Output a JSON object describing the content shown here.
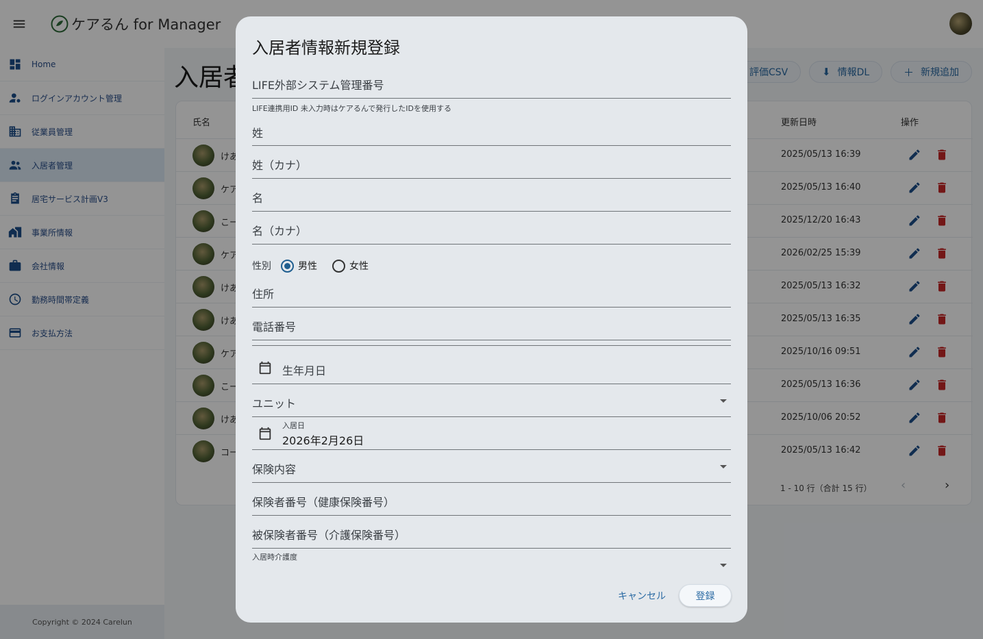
{
  "app": {
    "title": "ケアるん for Manager",
    "copyright": "Copyright © 2024 Carelun"
  },
  "sidebar": {
    "items": [
      {
        "label": "Home",
        "icon": "dashboard-icon"
      },
      {
        "label": "ログインアカウント管理",
        "icon": "manage-accounts-icon"
      },
      {
        "label": "従業員管理",
        "icon": "business-icon"
      },
      {
        "label": "入居者管理",
        "icon": "people-icon",
        "active": true
      },
      {
        "label": "居宅サービス計画V3",
        "icon": "assignment-icon"
      },
      {
        "label": "事業所情報",
        "icon": "home-work-icon"
      },
      {
        "label": "会社情報",
        "icon": "work-icon"
      },
      {
        "label": "勤務時間帯定義",
        "icon": "clock-icon"
      },
      {
        "label": "お支払方法",
        "icon": "credit-card-icon"
      }
    ]
  },
  "main": {
    "title": "入居者",
    "buttons": {
      "csv": "評価CSV",
      "download": "情報DL",
      "add": "新規追加"
    },
    "table": {
      "headers": {
        "name": "氏名",
        "updated": "更新日時",
        "actions": "操作"
      },
      "rows": [
        {
          "name": "けあ",
          "updated": "2025/05/13 16:39"
        },
        {
          "name": "ケア",
          "updated": "2025/05/13 16:40"
        },
        {
          "name": "こー",
          "updated": "2025/12/20 16:43"
        },
        {
          "name": "ケア",
          "updated": "2026/02/25 15:39"
        },
        {
          "name": "けあ",
          "updated": "2025/05/13 16:32"
        },
        {
          "name": "けあ",
          "updated": "2025/05/13 16:35"
        },
        {
          "name": "ケア",
          "updated": "2025/10/16 09:51"
        },
        {
          "name": "こー",
          "updated": "2025/05/13 16:36"
        },
        {
          "name": "けあ",
          "updated": "2025/10/06 20:52"
        },
        {
          "name": "コー",
          "updated": "2025/05/13 16:42"
        }
      ],
      "pagination": "1 - 10 行（合計 15 行）"
    }
  },
  "dialog": {
    "title": "入居者情報新規登録",
    "fields": {
      "life_id": {
        "label": "LIFE外部システム管理番号",
        "helper": "LIFE連携用ID 未入力時はケアるんで発行したIDを使用する"
      },
      "last_name": {
        "label": "姓"
      },
      "last_name_kana": {
        "label": "姓（カナ）"
      },
      "first_name": {
        "label": "名"
      },
      "first_name_kana": {
        "label": "名（カナ）"
      },
      "gender": {
        "label": "性別",
        "options": [
          "男性",
          "女性"
        ],
        "selected": "男性"
      },
      "address": {
        "label": "住所"
      },
      "phone": {
        "label": "電話番号"
      },
      "birthday": {
        "label": "生年月日"
      },
      "unit": {
        "label": "ユニット"
      },
      "move_in_date": {
        "label": "入居日",
        "value": "2026年2月26日"
      },
      "insurance": {
        "label": "保険内容"
      },
      "insurer_number": {
        "label": "保険者番号（健康保険番号）"
      },
      "insured_number": {
        "label": "被保険者番号（介護保険番号）"
      },
      "care_level": {
        "label": "入居時介護度"
      }
    },
    "buttons": {
      "cancel": "キャンセル",
      "submit": "登録"
    }
  },
  "colors": {
    "accent": "#1f5e8f",
    "delete": "#c62828",
    "edit": "#1d4f8a"
  }
}
